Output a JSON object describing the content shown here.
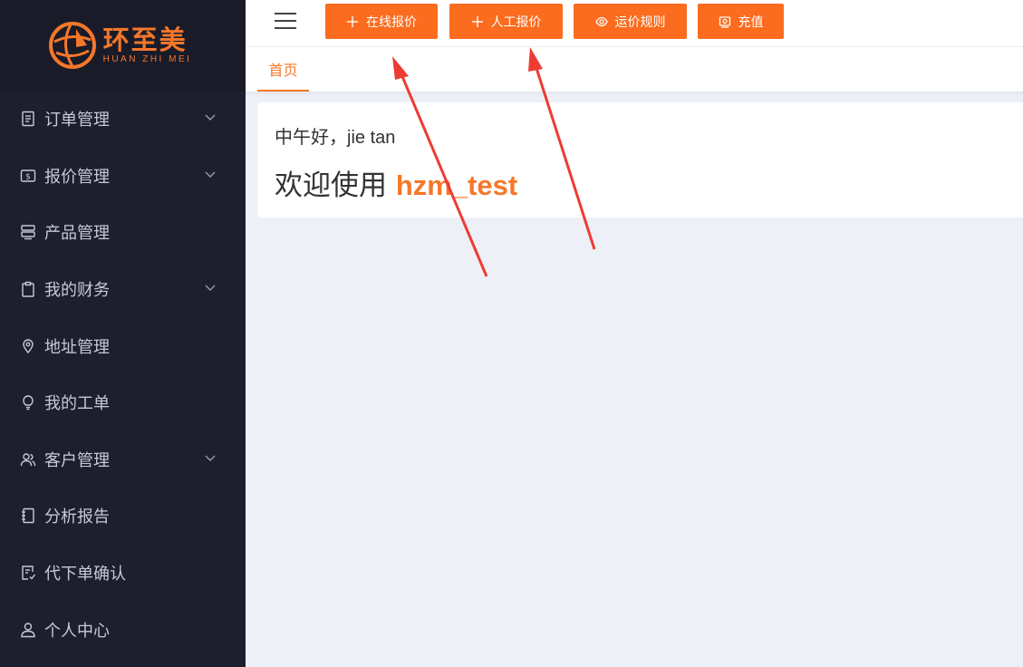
{
  "brand": {
    "name_cn": "环至美",
    "name_en": "HUAN ZHI MEI",
    "color": "#f5772a"
  },
  "sidebar": {
    "items": [
      {
        "label": "订单管理",
        "icon": "document-icon",
        "expandable": true
      },
      {
        "label": "报价管理",
        "icon": "price-tag-icon",
        "expandable": true
      },
      {
        "label": "产品管理",
        "icon": "server-icon",
        "expandable": false
      },
      {
        "label": "我的财务",
        "icon": "clipboard-icon",
        "expandable": true
      },
      {
        "label": "地址管理",
        "icon": "location-pin-icon",
        "expandable": false
      },
      {
        "label": "我的工单",
        "icon": "lightbulb-icon",
        "expandable": false
      },
      {
        "label": "客户管理",
        "icon": "users-icon",
        "expandable": true
      },
      {
        "label": "分析报告",
        "icon": "notebook-icon",
        "expandable": false
      },
      {
        "label": "代下单确认",
        "icon": "checklist-icon",
        "expandable": false
      },
      {
        "label": "个人中心",
        "icon": "user-icon",
        "expandable": false
      }
    ]
  },
  "toolbar": {
    "online_quote": "在线报价",
    "manual_quote": "人工报价",
    "shipping_rules": "运价规则",
    "recharge": "充值",
    "accent": "#fb6c1f"
  },
  "tabs": {
    "home": "首页"
  },
  "welcome": {
    "greeting": "中午好，jie tan",
    "prefix": "欢迎使用 ",
    "app_name": "hzm_test"
  }
}
